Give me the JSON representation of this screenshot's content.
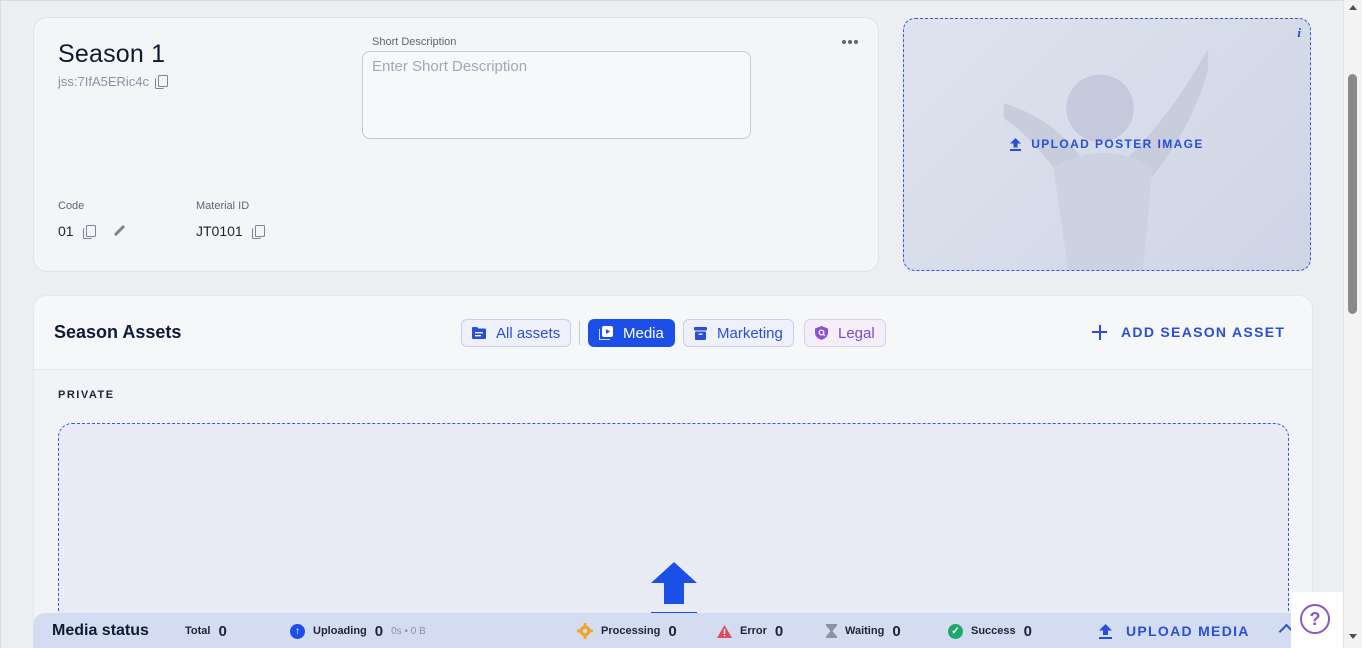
{
  "season": {
    "title": "Season 1",
    "id": "jss:7IfA5ERic4c",
    "short_description_label": "Short Description",
    "short_description_placeholder": "Enter Short Description",
    "short_description_value": "",
    "code_label": "Code",
    "code_value": "01",
    "material_id_label": "Material ID",
    "material_id_value": "JT0101"
  },
  "poster": {
    "info": "i",
    "upload_label": "UPLOAD POSTER IMAGE"
  },
  "assets": {
    "title": "Season Assets",
    "filters": [
      {
        "label": "All assets",
        "icon": "folder-icon",
        "state": "outline"
      },
      {
        "label": "Media",
        "icon": "media-icon",
        "state": "active"
      },
      {
        "label": "Marketing",
        "icon": "archive-icon",
        "state": "outline"
      },
      {
        "label": "Legal",
        "icon": "shield-icon",
        "state": "legal"
      }
    ],
    "add_label": "ADD SEASON ASSET",
    "section_label": "PRIVATE"
  },
  "media_status": {
    "title": "Media status",
    "total_label": "Total",
    "total_value": "0",
    "uploading_label": "Uploading",
    "uploading_value": "0",
    "uploading_detail": "0s • 0 B",
    "processing_label": "Processing",
    "processing_value": "0",
    "error_label": "Error",
    "error_value": "0",
    "waiting_label": "Waiting",
    "waiting_value": "0",
    "success_label": "Success",
    "success_value": "0",
    "upload_label": "UPLOAD MEDIA"
  },
  "colors": {
    "accent": "#1c4fe8",
    "legal": "#7d4bc0",
    "processing": "#f2a42a",
    "error": "#e04a5c",
    "success": "#1fa66a"
  },
  "help": "?"
}
